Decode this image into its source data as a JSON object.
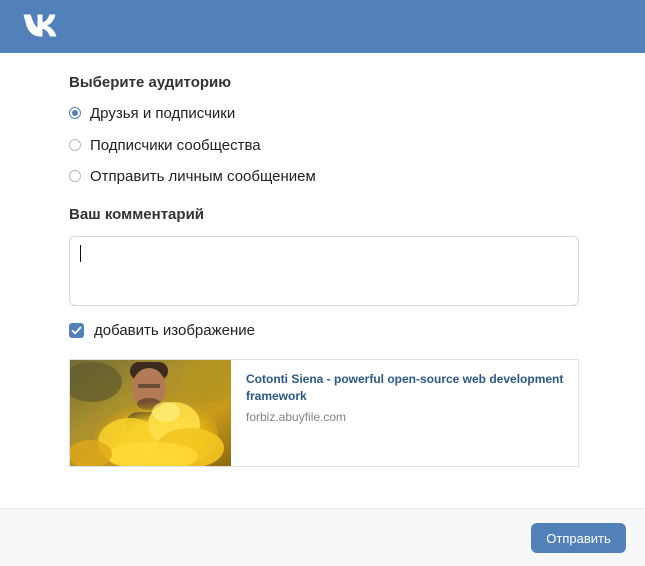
{
  "header": {
    "logo_icon": "vk-logo-icon",
    "background": "#5181b8"
  },
  "audience": {
    "title": "Выберите аудиторию",
    "options": [
      {
        "label": "Друзья и подписчики",
        "checked": true
      },
      {
        "label": "Подписчики сообщества",
        "checked": false
      },
      {
        "label": "Отправить личным сообщением",
        "checked": false
      }
    ]
  },
  "comment": {
    "title": "Ваш комментарий",
    "value": ""
  },
  "add_image": {
    "label": "добавить изображение",
    "checked": true
  },
  "link_preview": {
    "title": "Cotonti Siena - powerful open-source web development framework",
    "domain": "forbiz.abuyfile.com"
  },
  "footer": {
    "send_label": "Отправить"
  },
  "colors": {
    "accent": "#5181b8",
    "link": "#2a5885",
    "muted": "#828282"
  }
}
